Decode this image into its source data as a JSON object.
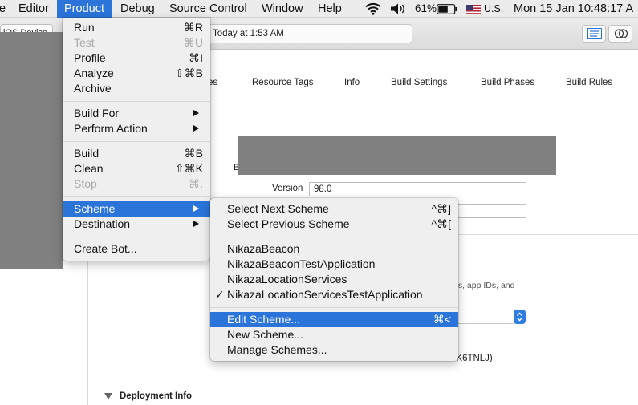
{
  "menubar": {
    "items": [
      {
        "label": "e"
      },
      {
        "label": "Editor"
      },
      {
        "label": "Product"
      },
      {
        "label": "Debug"
      },
      {
        "label": "Source Control"
      },
      {
        "label": "Window"
      },
      {
        "label": "Help"
      }
    ],
    "status": {
      "battery_percent": "61%",
      "input_source": "U.S.",
      "clock": "Mon 15 Jan  10:48:17 A"
    }
  },
  "toolbar": {
    "device": "iOS Device",
    "activity_text": "Today at 1:53 AM"
  },
  "editor": {
    "tabs": [
      "es",
      "Resource Tags",
      "Info",
      "Build Settings",
      "Build Phases",
      "Build Rules"
    ],
    "fragment_b": "B",
    "version_label": "Version",
    "version_value": "98.0",
    "bg_text_1": "es, app IDs, and",
    "bg_text_2": "3K6TNLJ)",
    "deployment_title": "Deployment Info"
  },
  "product_menu": {
    "group1": [
      {
        "label": "Run",
        "shortcut": "⌘R",
        "enabled": true
      },
      {
        "label": "Test",
        "shortcut": "⌘U",
        "enabled": false
      },
      {
        "label": "Profile",
        "shortcut": "⌘I",
        "enabled": true
      },
      {
        "label": "Analyze",
        "shortcut": "⇧⌘B",
        "enabled": true
      },
      {
        "label": "Archive",
        "shortcut": "",
        "enabled": true
      }
    ],
    "group2": [
      {
        "label": "Build For"
      },
      {
        "label": "Perform Action"
      }
    ],
    "group3": [
      {
        "label": "Build",
        "shortcut": "⌘B",
        "enabled": true
      },
      {
        "label": "Clean",
        "shortcut": "⇧⌘K",
        "enabled": true
      },
      {
        "label": "Stop",
        "shortcut": "⌘.",
        "enabled": false
      }
    ],
    "group4": [
      {
        "label": "Scheme"
      },
      {
        "label": "Destination"
      }
    ],
    "group5": [
      {
        "label": "Create Bot..."
      }
    ]
  },
  "scheme_menu": {
    "navigation": [
      {
        "label": "Select Next Scheme",
        "shortcut": "^⌘]"
      },
      {
        "label": "Select Previous Scheme",
        "shortcut": "^⌘["
      }
    ],
    "schemes": [
      {
        "label": "NikazaBeacon",
        "checked": false
      },
      {
        "label": "NikazaBeaconTestApplication",
        "checked": false
      },
      {
        "label": "NikazaLocationServices",
        "checked": false
      },
      {
        "label": "NikazaLocationServicesTestApplication",
        "checked": true
      }
    ],
    "check_mark": "✓",
    "manage": [
      {
        "label": "Edit Scheme...",
        "shortcut": "⌘<"
      },
      {
        "label": "New Scheme...",
        "shortcut": ""
      },
      {
        "label": "Manage Schemes...",
        "shortcut": ""
      }
    ]
  }
}
